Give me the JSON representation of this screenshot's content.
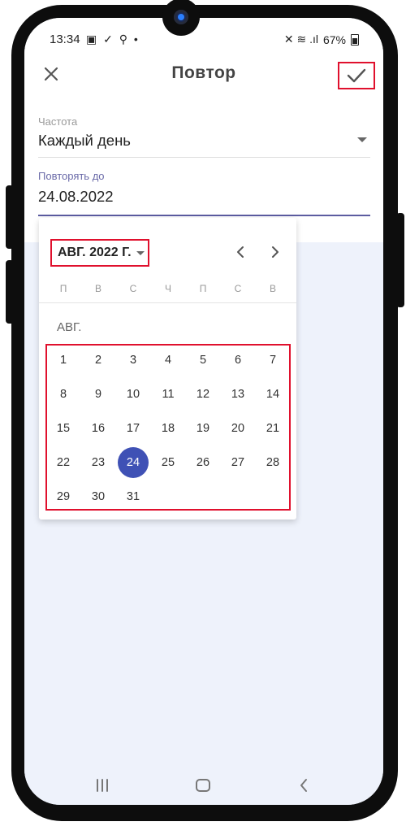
{
  "status_bar": {
    "time": "13:34",
    "left_icons": "▣ ✓ ⚲ •",
    "right_icons": "✕ ≋ .ıl",
    "battery": "67%"
  },
  "app_bar": {
    "title": "Повтор",
    "close_icon": "close-icon",
    "confirm_icon": "check-icon"
  },
  "form": {
    "frequency": {
      "label": "Частота",
      "value": "Каждый день"
    },
    "repeat_until": {
      "label": "Повторять до",
      "value": "24.08.2022"
    }
  },
  "date_picker": {
    "month_year": "АВГ. 2022 Г.",
    "weekdays": [
      "П",
      "В",
      "С",
      "Ч",
      "П",
      "С",
      "В"
    ],
    "month_heading": "АВГ.",
    "days": [
      "1",
      "2",
      "3",
      "4",
      "5",
      "6",
      "7",
      "8",
      "9",
      "10",
      "11",
      "12",
      "13",
      "14",
      "15",
      "16",
      "17",
      "18",
      "19",
      "20",
      "21",
      "22",
      "23",
      "24",
      "25",
      "26",
      "27",
      "28",
      "29",
      "30",
      "31"
    ],
    "selected_day": "24",
    "accent_color": "#3f51b5"
  },
  "nav_bar": {
    "recents_icon": "recents-icon",
    "home_icon": "home-icon",
    "back_icon": "back-icon"
  },
  "colors": {
    "highlight_border": "#e0102d",
    "screen_background": "#eef2fb"
  }
}
